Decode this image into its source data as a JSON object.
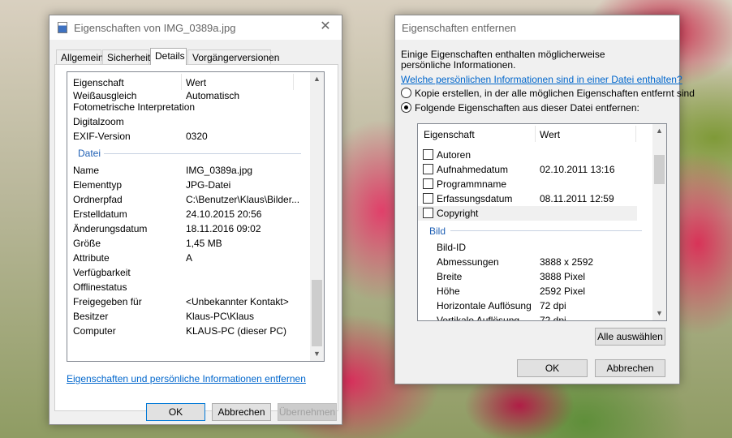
{
  "left_dialog": {
    "title": "Eigenschaften von IMG_0389a.jpg",
    "close_glyph": "✕",
    "tabs": [
      "Allgemein",
      "Sicherheit",
      "Details",
      "Vorgängerversionen"
    ],
    "columns": [
      "Eigenschaft",
      "Wert"
    ],
    "partial_row": {
      "name": "Weißausgleich",
      "value": "Automatisch"
    },
    "rows_top": [
      {
        "name": "Fotometrische Interpretation",
        "value": ""
      },
      {
        "name": "Digitalzoom",
        "value": ""
      },
      {
        "name": "EXIF-Version",
        "value": "0320"
      }
    ],
    "group": "Datei",
    "rows_file": [
      {
        "name": "Name",
        "value": "IMG_0389a.jpg"
      },
      {
        "name": "Elementtyp",
        "value": "JPG-Datei"
      },
      {
        "name": "Ordnerpfad",
        "value": "C:\\Benutzer\\Klaus\\Bilder..."
      },
      {
        "name": "Erstelldatum",
        "value": "24.10.2015 20:56"
      },
      {
        "name": "Änderungsdatum",
        "value": "18.11.2016 09:02"
      },
      {
        "name": "Größe",
        "value": "1,45 MB"
      },
      {
        "name": "Attribute",
        "value": "A"
      },
      {
        "name": "Verfügbarkeit",
        "value": ""
      },
      {
        "name": "Offlinestatus",
        "value": ""
      },
      {
        "name": "Freigegeben für",
        "value": "<Unbekannter Kontakt>"
      },
      {
        "name": "Besitzer",
        "value": "Klaus-PC\\Klaus"
      },
      {
        "name": "Computer",
        "value": "KLAUS-PC (dieser PC)"
      }
    ],
    "remove_link": "Eigenschaften und persönliche Informationen entfernen",
    "ok": "OK",
    "cancel": "Abbrechen",
    "apply": "Übernehmen"
  },
  "right_dialog": {
    "title": "Eigenschaften entfernen",
    "intro": "Einige Eigenschaften enthalten möglicherweise persönliche Informationen.",
    "info_link": "Welche persönlichen Informationen sind in einer Datei enthalten?",
    "radio_copy": "Kopie erstellen, in der alle möglichen Eigenschaften entfernt sind",
    "radio_remove": "Folgende Eigenschaften aus dieser Datei entfernen:",
    "columns": [
      "Eigenschaft",
      "Wert"
    ],
    "checked_rows": [
      {
        "name": "Autoren",
        "value": ""
      },
      {
        "name": "Aufnahmedatum",
        "value": "02.10.2011 13:16"
      },
      {
        "name": "Programmname",
        "value": ""
      },
      {
        "name": "Erfassungsdatum",
        "value": "08.11.2011 12:59"
      },
      {
        "name": "Copyright",
        "value": ""
      }
    ],
    "group": "Bild",
    "image_rows": [
      {
        "name": "Bild-ID",
        "value": ""
      },
      {
        "name": "Abmessungen",
        "value": "3888 x 2592"
      },
      {
        "name": "Breite",
        "value": "3888 Pixel"
      },
      {
        "name": "Höhe",
        "value": "2592 Pixel"
      },
      {
        "name": "Horizontale Auflösung",
        "value": "72 dpi"
      }
    ],
    "partial_row": {
      "name": "Vertikale Auflösung",
      "value": "72 dpi"
    },
    "select_all": "Alle auswählen",
    "ok": "OK",
    "cancel": "Abbrechen"
  }
}
